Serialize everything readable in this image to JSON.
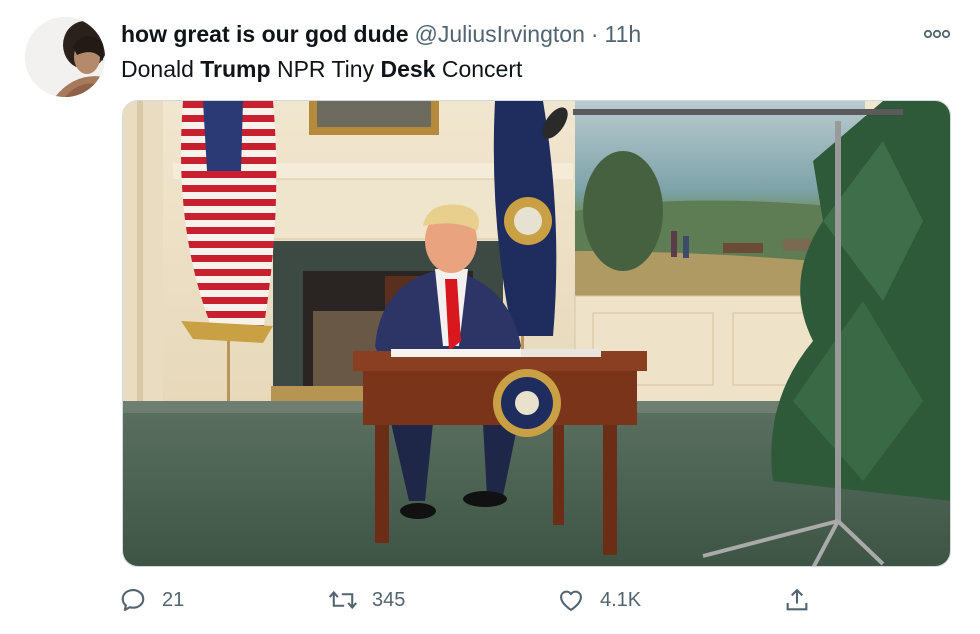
{
  "tweet": {
    "display_name": "how great is our god dude",
    "handle": "@JuliusIrvington",
    "separator": "·",
    "time": "11h",
    "text": [
      {
        "t": "Donald ",
        "bold": false
      },
      {
        "t": "Trump",
        "bold": true
      },
      {
        "t": " NPR Tiny ",
        "bold": false
      },
      {
        "t": "Desk",
        "bold": true
      },
      {
        "t": " Concert",
        "bold": false
      }
    ]
  },
  "actions": {
    "reply_count": "21",
    "retweet_count": "345",
    "like_count": "4.1K"
  },
  "icons": {
    "more": "more-horizontal-icon",
    "reply": "reply-icon",
    "retweet": "retweet-icon",
    "like": "heart-icon",
    "share": "share-icon"
  },
  "colors": {
    "text": "#0f1419",
    "secondary": "#536471",
    "border": "#cfd9de"
  }
}
